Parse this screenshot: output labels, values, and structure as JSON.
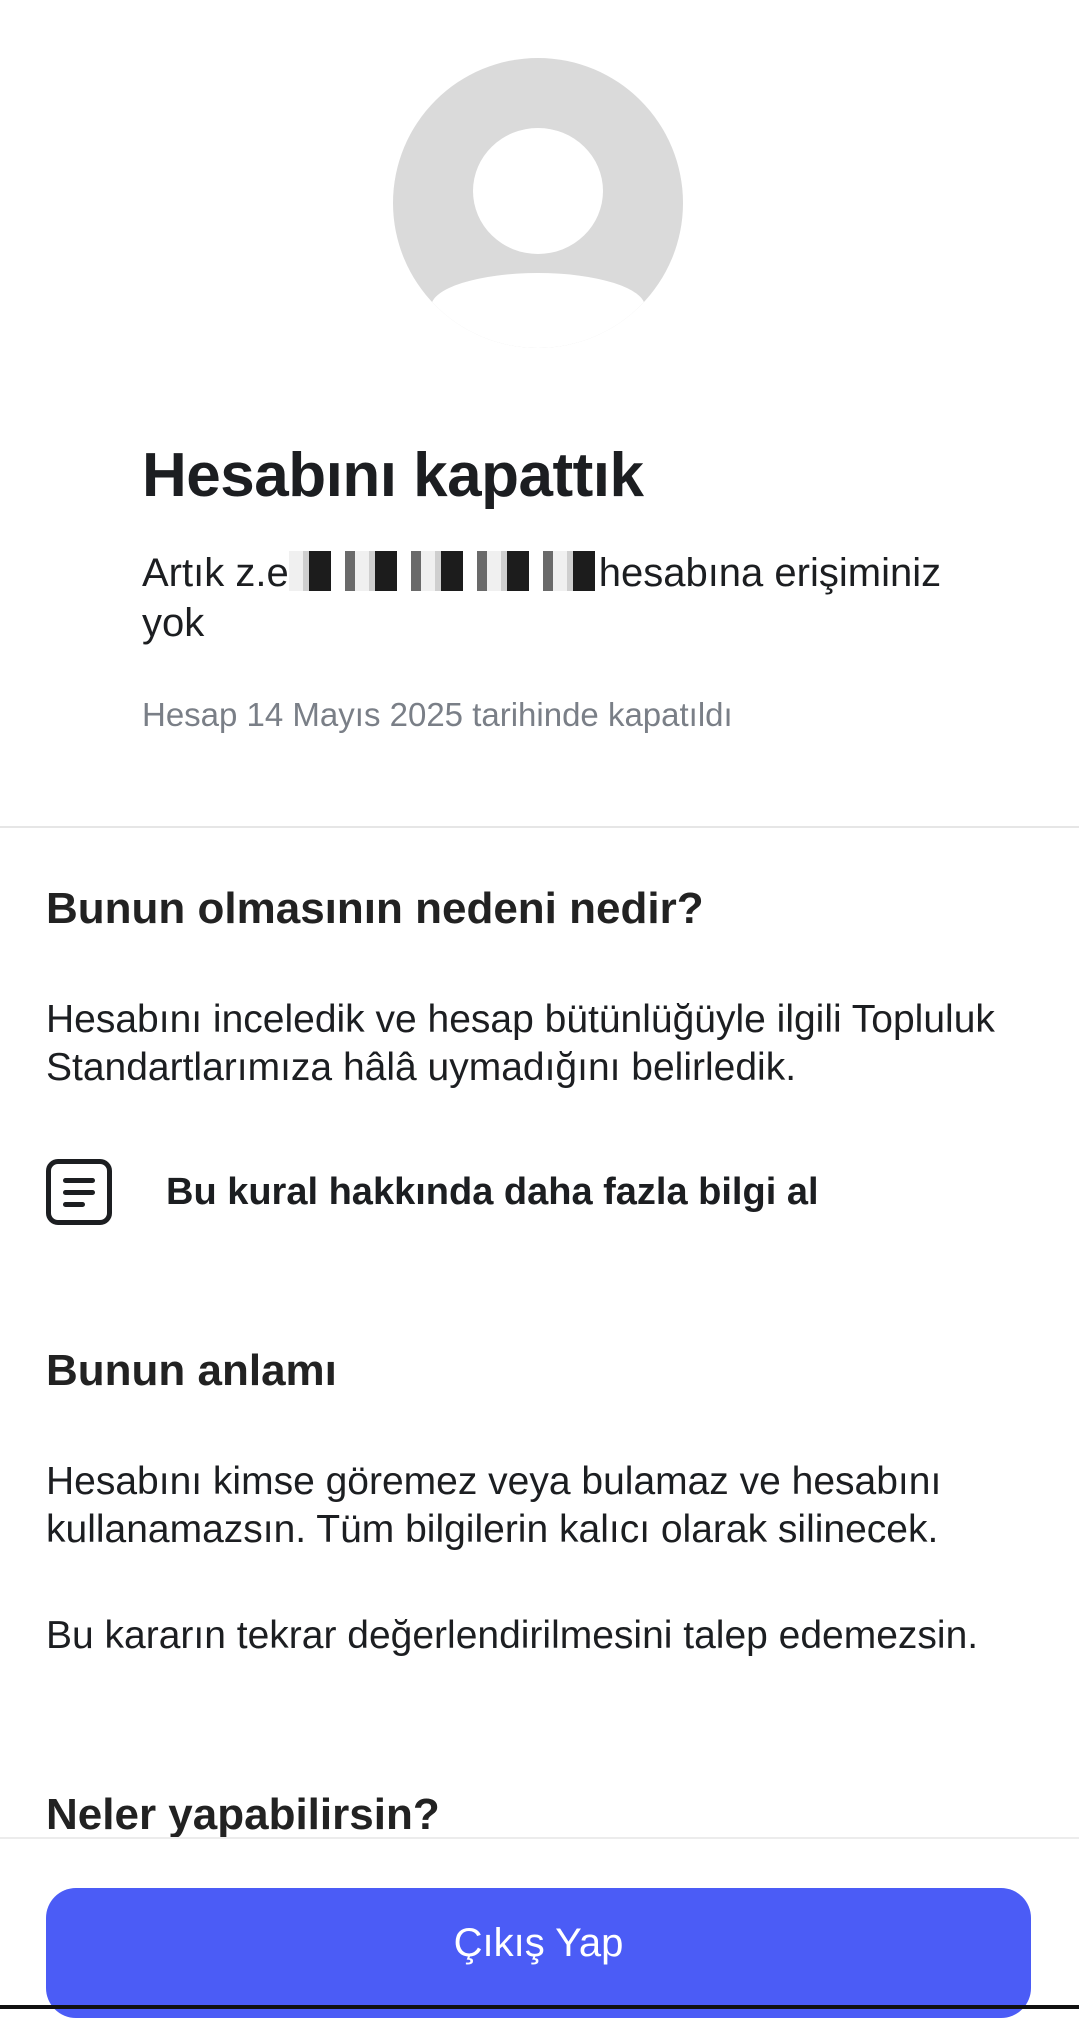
{
  "header": {
    "title": "Hesabını kapattık",
    "notice_prefix": "Artık z.e",
    "notice_suffix": "hesabına erişiminiz yok",
    "closed_date": "Hesap 14 Mayıs 2025 tarihinde kapatıldı"
  },
  "reason": {
    "heading": "Bunun olmasının nedeni nedir?",
    "text": "Hesabını inceledik ve hesap bütünlüğüyle ilgili Topluluk Standartlarımıza hâlâ uymadığını belirledik.",
    "rule_link_label": "Bu kural hakkında daha fazla bilgi al",
    "rule_link_icon": "document-icon"
  },
  "meaning": {
    "heading": "Bunun anlamı",
    "text1": "Hesabını kimse göremez veya bulamaz ve hesabını kullanamazsın. Tüm bilgilerin kalıcı olarak silinecek.",
    "text2": "Bu kararın tekrar değerlendirilmesini talep edemezsin."
  },
  "next": {
    "heading": "Neler yapabilirsin?"
  },
  "footer": {
    "logout_label": "Çıkış Yap"
  },
  "colors": {
    "accent": "#4b5cf6",
    "muted_text": "#7a7f87",
    "avatar_bg": "#dadada"
  }
}
